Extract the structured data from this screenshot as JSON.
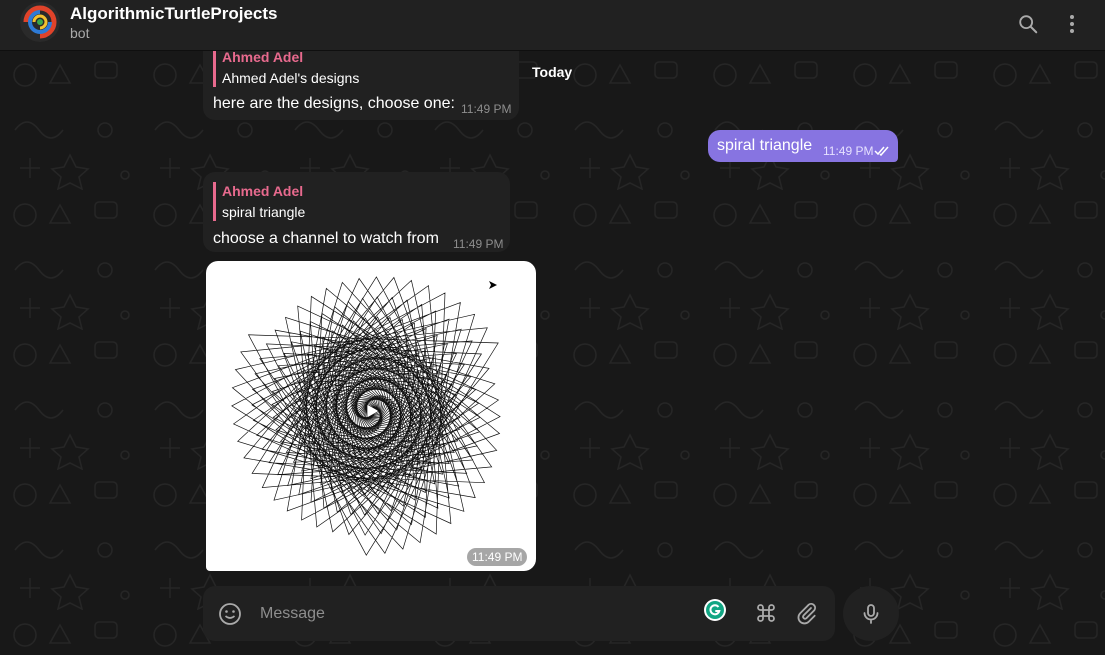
{
  "header": {
    "title": "AlgorithmicTurtleProjects",
    "subtitle": "bot"
  },
  "colors": {
    "accent": "#8774e1",
    "reply_name": "#e86a8e",
    "bubble": "#212121",
    "background": "#181818"
  },
  "icons": {
    "search": "search-icon",
    "more": "more-vertical-icon",
    "emoji": "smile-icon",
    "commands": "command-icon",
    "attach": "paperclip-icon",
    "mic": "microphone-icon",
    "grammarly": "grammarly-icon"
  },
  "date_separator": "Today",
  "messages": [
    {
      "reply_name": "Ahmed Adel",
      "reply_text": "Ahmed Adel's designs",
      "text": "here are the designs, choose one:",
      "time": "11:49 PM"
    },
    {
      "text": "spiral triangle",
      "time": "11:49 PM"
    },
    {
      "reply_name": "Ahmed Adel",
      "reply_text": "spiral triangle",
      "text": "choose a channel to watch from",
      "time": "11:49 PM"
    },
    {
      "image": "spiral triangle turtle drawing",
      "time": "11:49 PM"
    }
  ],
  "composer": {
    "placeholder": "Message"
  }
}
